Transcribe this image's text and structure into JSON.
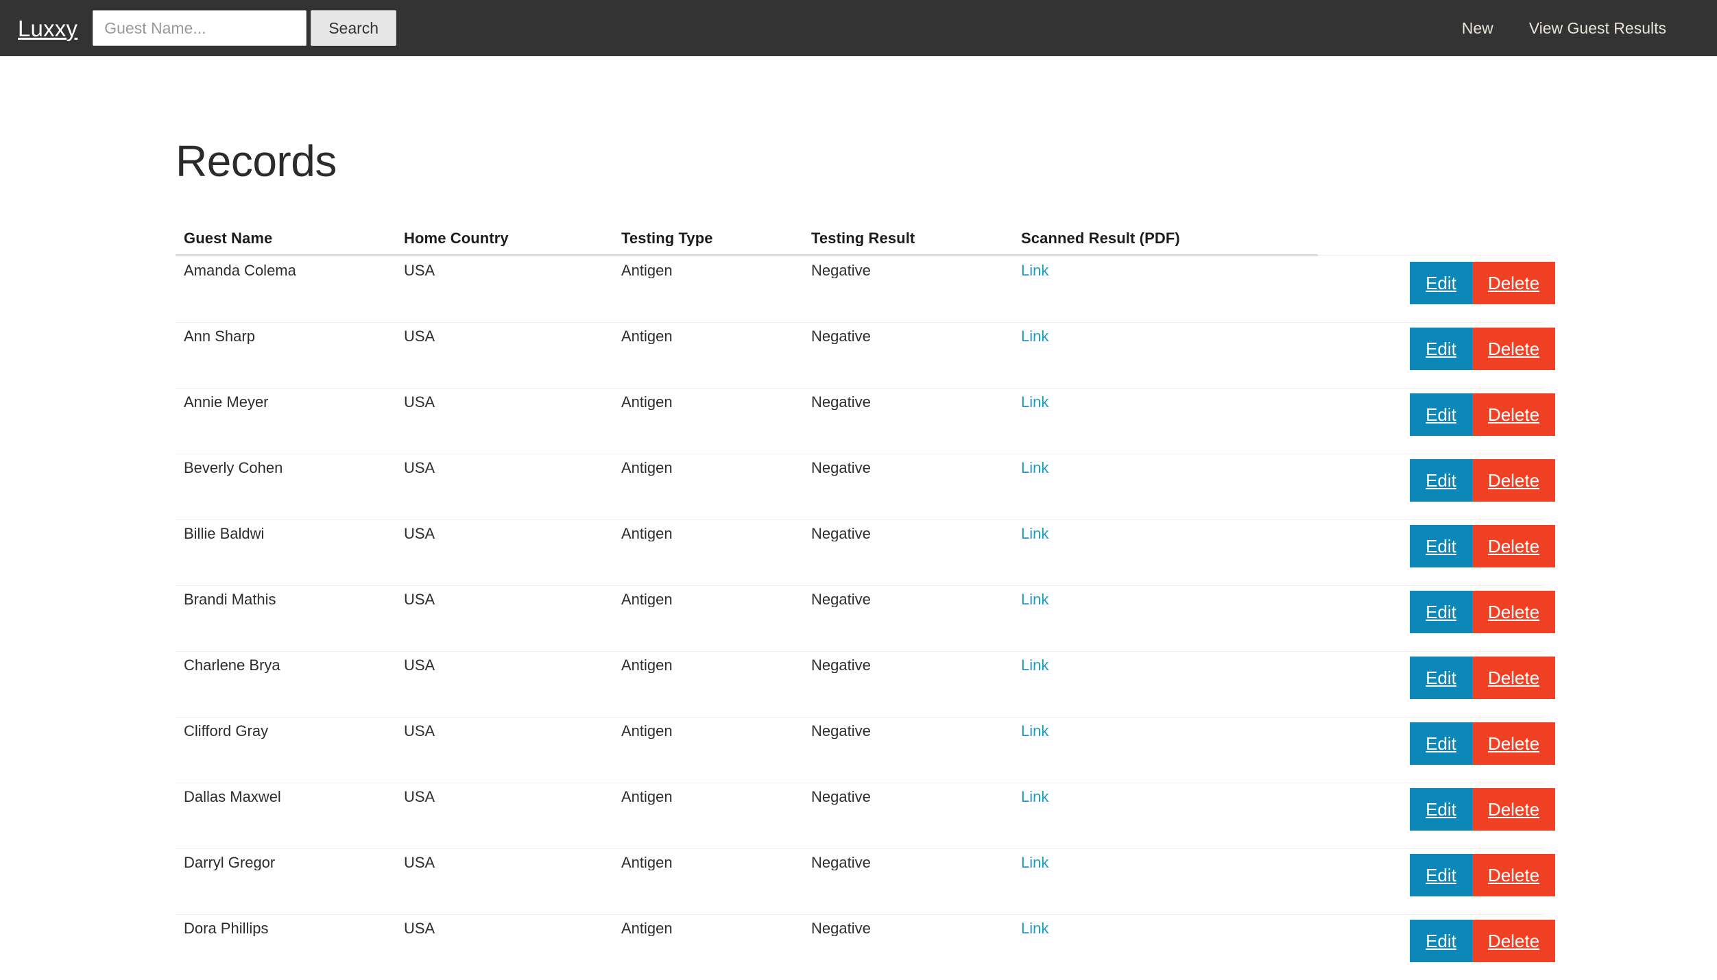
{
  "navbar": {
    "brand": "Luxxy",
    "search": {
      "placeholder": "Guest Name...",
      "value": "",
      "button_label": "Search"
    },
    "links": [
      {
        "label": "New"
      },
      {
        "label": "View Guest Results"
      }
    ],
    "background_color": "#333333"
  },
  "main": {
    "title": "Records",
    "table": {
      "columns": [
        "Guest Name",
        "Home Country",
        "Testing Type",
        "Testing Result",
        "Scanned Result (PDF)"
      ],
      "link_label": "Link",
      "edit_label": "Edit",
      "delete_label": "Delete",
      "edit_color": "#0d87b8",
      "delete_color": "#f04124",
      "link_color": "#2199c7",
      "rows": [
        {
          "name": "Amanda Colema",
          "country": "USA",
          "type": "Antigen",
          "result": "Negative",
          "pdf": "Link"
        },
        {
          "name": "Ann Sharp",
          "country": "USA",
          "type": "Antigen",
          "result": "Negative",
          "pdf": "Link"
        },
        {
          "name": "Annie Meyer",
          "country": "USA",
          "type": "Antigen",
          "result": "Negative",
          "pdf": "Link"
        },
        {
          "name": "Beverly Cohen",
          "country": "USA",
          "type": "Antigen",
          "result": "Negative",
          "pdf": "Link"
        },
        {
          "name": "Billie Baldwi",
          "country": "USA",
          "type": "Antigen",
          "result": "Negative",
          "pdf": "Link"
        },
        {
          "name": "Brandi Mathis",
          "country": "USA",
          "type": "Antigen",
          "result": "Negative",
          "pdf": "Link"
        },
        {
          "name": "Charlene Brya",
          "country": "USA",
          "type": "Antigen",
          "result": "Negative",
          "pdf": "Link"
        },
        {
          "name": "Clifford Gray",
          "country": "USA",
          "type": "Antigen",
          "result": "Negative",
          "pdf": "Link"
        },
        {
          "name": "Dallas Maxwel",
          "country": "USA",
          "type": "Antigen",
          "result": "Negative",
          "pdf": "Link"
        },
        {
          "name": "Darryl Gregor",
          "country": "USA",
          "type": "Antigen",
          "result": "Negative",
          "pdf": "Link"
        },
        {
          "name": "Dora Phillips",
          "country": "USA",
          "type": "Antigen",
          "result": "Negative",
          "pdf": "Link"
        }
      ]
    }
  }
}
